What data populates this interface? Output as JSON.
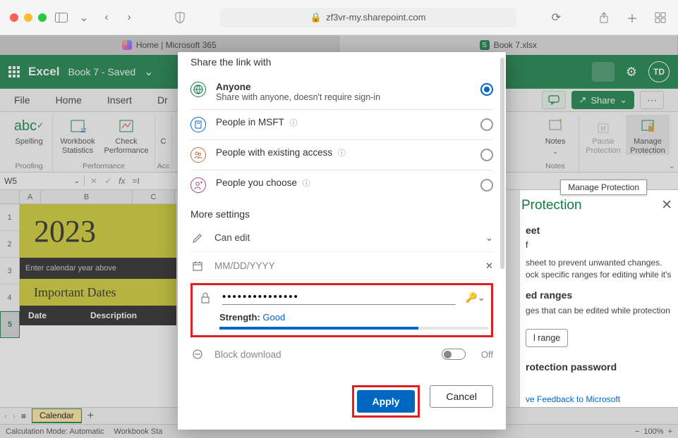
{
  "browser": {
    "url_host": "zf3vr-my.sharepoint.com",
    "tabs": [
      {
        "label": "Home | Microsoft 365",
        "active": false
      },
      {
        "label": "Book 7.xlsx",
        "active": true
      }
    ]
  },
  "excel_header": {
    "app": "Excel",
    "doc": "Book 7 - Saved",
    "avatar": "TD"
  },
  "ribbon_tabs": [
    "File",
    "Home",
    "Insert",
    "Dr"
  ],
  "ribbon_right": {
    "share": "Share"
  },
  "ribbon": {
    "proofing": {
      "label": "Proofing",
      "items": [
        "Spelling"
      ]
    },
    "performance": {
      "label": "Performance",
      "items": [
        "Workbook Statistics",
        "Check Performance"
      ]
    },
    "acc": {
      "label_partial": "Acc",
      "item_partial": "C"
    },
    "notes": {
      "label": "Notes",
      "item": "Notes"
    },
    "protection": {
      "label": "Protection",
      "items": [
        "Pause Protection",
        "Manage Protection"
      ]
    }
  },
  "tooltip": "Manage Protection",
  "formula_bar": {
    "namebox": "W5",
    "formula_prefix": "=I"
  },
  "sheet": {
    "cols": [
      "A",
      "B",
      "C"
    ],
    "rows": [
      "1",
      "2",
      "3",
      "4",
      "5"
    ],
    "year": "2023",
    "year_hint": "Enter calendar year above",
    "important": "Important Dates",
    "hdr_date": "Date",
    "hdr_desc": "Description"
  },
  "protection_panel": {
    "title": "Protection",
    "sheet_word": "eet",
    "word_f": "f",
    "desc": "sheet to prevent unwanted changes. ock specific ranges for editing while it's",
    "ranges_title": "ed ranges",
    "ranges_desc": "ges that can be edited while protection",
    "range_btn": "l range",
    "pw_title": "rotection password",
    "feedback": "ve Feedback to Microsoft"
  },
  "sheet_tabs": {
    "active": "Calendar"
  },
  "status": {
    "calc": "Calculation Mode: Automatic",
    "stats": "Workbook Sta",
    "zoom": "100%"
  },
  "modal": {
    "heading": "Share the link with",
    "options": [
      {
        "title": "Anyone",
        "sub": "Share with anyone, doesn't require sign-in",
        "selected": true
      },
      {
        "title": "People in MSFT",
        "sub": "",
        "selected": false
      },
      {
        "title": "People with existing access",
        "sub": "",
        "selected": false
      },
      {
        "title": "People you choose",
        "sub": "",
        "selected": false
      }
    ],
    "more_settings": "More settings",
    "can_edit": "Can edit",
    "date_placeholder": "MM/DD/YYYY",
    "password_mask": "•••••••••••••••",
    "strength_label": "Strength:",
    "strength_value": "Good",
    "block_dl": "Block download",
    "block_state": "Off",
    "apply": "Apply",
    "cancel": "Cancel"
  }
}
